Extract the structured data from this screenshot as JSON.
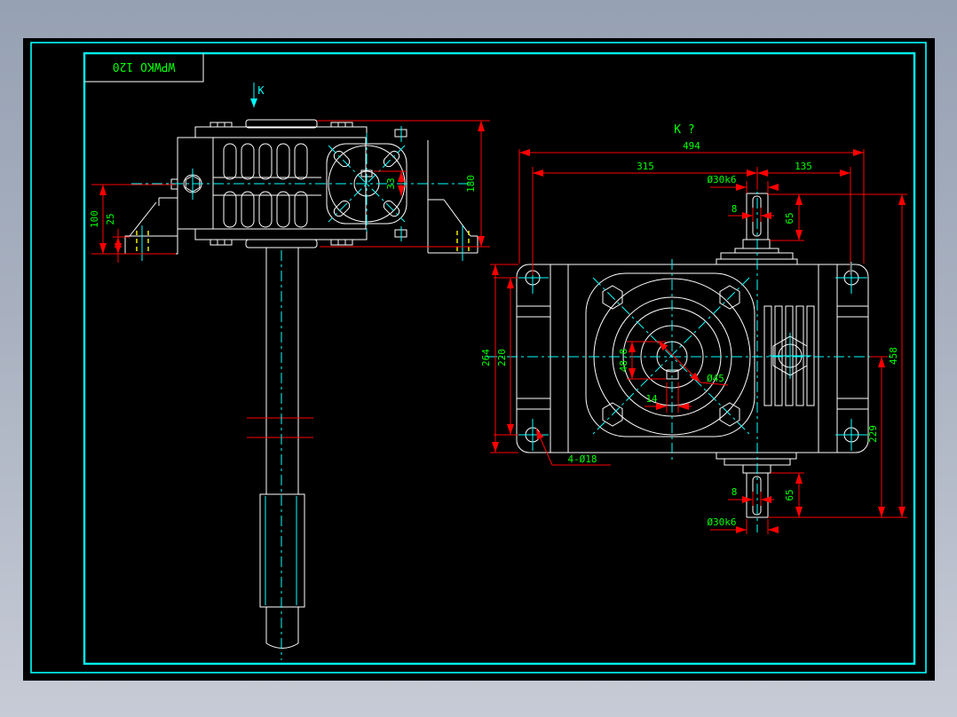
{
  "colors": {
    "background_top": "#96a1b3",
    "background_bottom": "#c6cbd6",
    "canvas": "#000000",
    "frame": "#00ffff",
    "lines": "#ffffff",
    "centerlines": "#00ffff",
    "dimensions": "#ff0000",
    "dim_text": "#00ff00",
    "hidden_lines": "#ffff00"
  },
  "title_block": {
    "label": "WPWKO 120"
  },
  "left_view": {
    "view_label": "K",
    "dim_key_33": "33",
    "dim_180": "180",
    "dim_100": "100",
    "dim_25": "25"
  },
  "right_view": {
    "view_label": "K ?",
    "dim_494": "494",
    "dim_315": "315",
    "dim_135": "135",
    "top_shaft_dia": "Ø30k6",
    "top_key_width": "8",
    "top_shaft_len": "65",
    "dim_264": "264",
    "dim_220": "220",
    "key_depth": "48.8",
    "key_width": "14",
    "bore_dia": "Ø45",
    "dim_458": "458",
    "dim_229": "229",
    "foot_holes": "4-Ø18",
    "bottom_key_width": "8",
    "bottom_shaft_len": "65",
    "bottom_shaft_dia": "Ø30k6"
  }
}
